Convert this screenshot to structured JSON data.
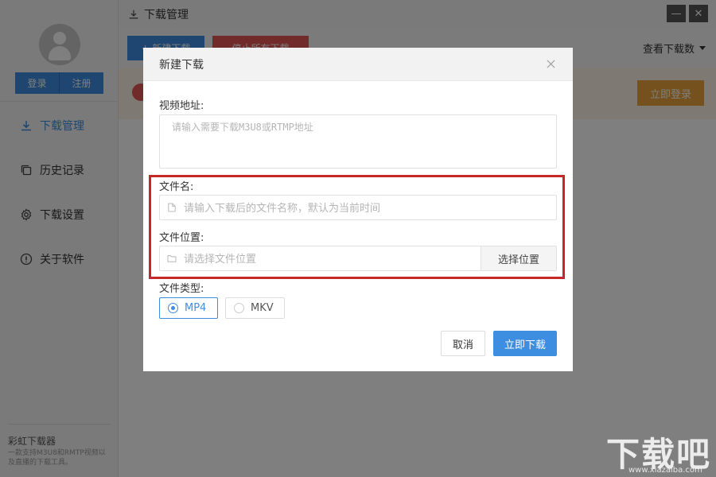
{
  "sidebar": {
    "login_label": "登录",
    "register_label": "注册",
    "items": [
      {
        "label": "下载管理",
        "icon": "download-icon",
        "active": true
      },
      {
        "label": "历史记录",
        "icon": "copy-icon",
        "active": false
      },
      {
        "label": "下载设置",
        "icon": "gear-icon",
        "active": false
      },
      {
        "label": "关于软件",
        "icon": "info-icon",
        "active": false
      }
    ],
    "app_name": "彩虹下载器",
    "app_desc": "一款支持M3U8和RMTP视频以及直播的下载工具。"
  },
  "titlebar": {
    "title": "下载管理",
    "minimize_symbol": "—",
    "close_symbol": "✕"
  },
  "toolbar": {
    "new_label": "+ 新建下载",
    "stop_all_label": "停止所有下载",
    "view_count_label": "查看下载数"
  },
  "notice": {
    "login_now_label": "立即登录"
  },
  "dialog": {
    "title": "新建下载",
    "url_label": "视频地址:",
    "url_placeholder": "请输入需要下载M3U8或RTMP地址",
    "filename_label": "文件名:",
    "filename_placeholder": "请输入下载后的文件名称，默认为当前时间",
    "location_label": "文件位置:",
    "location_placeholder": "请选择文件位置",
    "choose_label": "选择位置",
    "type_label": "文件类型:",
    "types": [
      {
        "label": "MP4",
        "checked": true
      },
      {
        "label": "MKV",
        "checked": false
      }
    ],
    "cancel_label": "取消",
    "download_label": "立即下载"
  },
  "watermark": {
    "text": "下载吧",
    "url": "www.xiazaiba.com"
  },
  "colors": {
    "accent": "#3d8de0",
    "danger": "#e25656",
    "warning": "#e8a23a",
    "highlight_border": "#c62828"
  }
}
